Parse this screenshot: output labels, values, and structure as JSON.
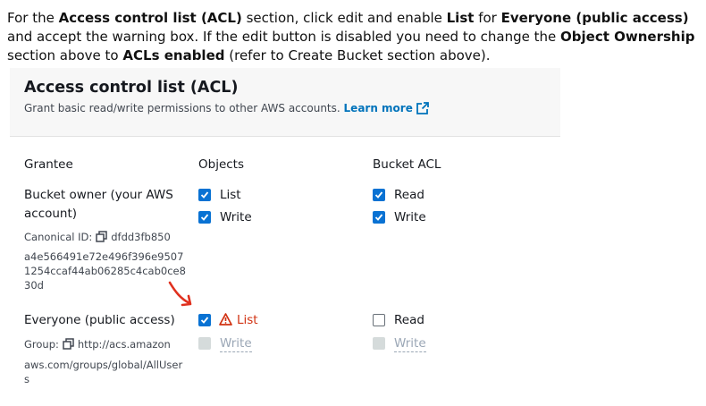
{
  "instruction": {
    "t1": "For the ",
    "b1": "Access control list (ACL)",
    "t2": " section, click edit and enable ",
    "b2": "List",
    "t3": " for ",
    "b3": "Everyone (public access)",
    "t4": " and accept the warning box. If the edit button is disabled you need to change the ",
    "b4": "Object Ownership",
    "t5": " section above to ",
    "b5": "ACLs enabled",
    "t6": " (refer to Create Bucket section above)."
  },
  "panel": {
    "title": "Access control list (ACL)",
    "description": "Grant basic read/write permissions to other AWS accounts.",
    "learn_more": "Learn more"
  },
  "columns": {
    "grantee": "Grantee",
    "objects": "Objects",
    "bucket_acl": "Bucket ACL"
  },
  "rows": [
    {
      "grantee_line1": "Bucket owner (your AWS",
      "grantee_line2": "account)",
      "id_label": "Canonical ID:",
      "id_line1": "dfdd3fb850",
      "id_line2": "a4e566491e72e496f396e9507",
      "id_line3": "1254ccaf44ab06285c4cab0ce8",
      "id_line4": "30d",
      "objects_list": "List",
      "objects_write": "Write",
      "bucket_read": "Read",
      "bucket_write": "Write"
    },
    {
      "grantee_line1": "Everyone (public access)",
      "group_label": "Group:",
      "group_line1": "http://acs.amazon",
      "group_line2": "aws.com/groups/global/AllUser",
      "group_line3": "s",
      "objects_list": "List",
      "objects_write": "Write",
      "bucket_read": "Read",
      "bucket_write": "Write"
    }
  ],
  "colors": {
    "accent": "#0972d3",
    "link": "#0073bb",
    "warning": "#d13212",
    "arrow": "#e0301e"
  }
}
